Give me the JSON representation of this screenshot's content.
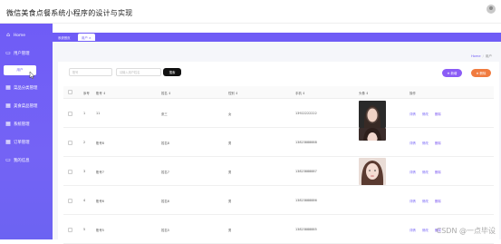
{
  "app": {
    "title": "微信美食点餐系统小程序的设计与实现"
  },
  "sidebar": {
    "items": [
      {
        "label": "Home",
        "icon": "home-icon"
      },
      {
        "label": "用户管理",
        "icon": "chat-icon"
      },
      {
        "label": "菜品分类管理",
        "icon": "grid-icon"
      },
      {
        "label": "美食菜品管理",
        "icon": "grid-icon"
      },
      {
        "label": "系统管理",
        "icon": "grid-icon"
      },
      {
        "label": "订单管理",
        "icon": "grid-icon"
      },
      {
        "label": "我的信息",
        "icon": "card-icon"
      }
    ],
    "sub_item": "用户"
  },
  "tabs": [
    {
      "label": "系统首页"
    },
    {
      "label": "用户 ×"
    }
  ],
  "breadcrumb": {
    "home": "Home",
    "sep": "/",
    "current": "用户"
  },
  "search": {
    "account_placeholder": "账号",
    "name_placeholder": "请输入用户姓名",
    "button": "搜索"
  },
  "toolbar": {
    "add_label": "⊕ 新增",
    "delete_label": "⊗ 删除",
    "add_color": "#8b5cf6",
    "delete_color": "#f07b3f"
  },
  "table": {
    "headers": [
      "序号",
      "账号 ⇕",
      "姓名 ⇕",
      "性别 ⇕",
      "手机 ⇕",
      "头像 ⇕",
      "操作"
    ],
    "rows": [
      {
        "index": "1",
        "account": "11",
        "name": "张三",
        "gender": "女",
        "phone": "13922222222",
        "has_photo": true,
        "actions": [
          "详情",
          "修改",
          "删除"
        ]
      },
      {
        "index": "2",
        "account": "账号8",
        "name": "姓名8",
        "gender": "男",
        "phone": "13823888888",
        "has_photo": true,
        "actions": [
          "详情",
          "修改",
          "删除"
        ]
      },
      {
        "index": "3",
        "account": "账号7",
        "name": "姓名7",
        "gender": "男",
        "phone": "13823888887",
        "has_photo": true,
        "actions": [
          "详情",
          "修改",
          "删除"
        ]
      },
      {
        "index": "4",
        "account": "账号6",
        "name": "姓名6",
        "gender": "男",
        "phone": "13823888886",
        "has_photo": false,
        "actions": [
          "详情",
          "修改",
          "删除"
        ]
      },
      {
        "index": "5",
        "account": "账号5",
        "name": "姓名5",
        "gender": "男",
        "phone": "13823888885",
        "has_photo": false,
        "actions": [
          "详情",
          "修改",
          "删除"
        ]
      }
    ]
  },
  "watermark": "CSDN @一点毕设",
  "colors": {
    "accent": "#6f5cf6",
    "action_detail": "#6f5cf6",
    "action_edit": "#6f5cf6",
    "action_delete": "#7a55f0"
  }
}
